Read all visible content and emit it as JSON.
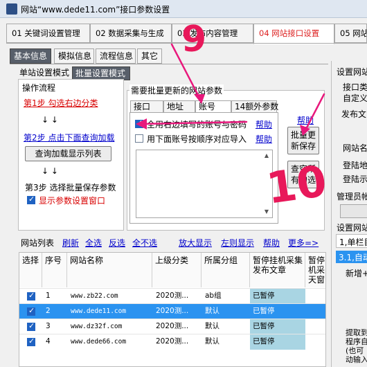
{
  "window": {
    "title": "网站“www.dede11.com”接口参数设置"
  },
  "main_tabs": [
    {
      "label": "01 关键词设置管理"
    },
    {
      "label": "02 数据采集与生成"
    },
    {
      "label": "03 发布内容管理"
    },
    {
      "label": "04 网站接口设置"
    },
    {
      "label": "05 网站"
    }
  ],
  "sub_tabs": [
    {
      "label": "基本信息"
    },
    {
      "label": "模拟信息"
    },
    {
      "label": "流程信息"
    },
    {
      "label": "其它"
    }
  ],
  "mode_tabs": [
    {
      "label": "单站设置模式"
    },
    {
      "label": "批量设置模式"
    }
  ],
  "flow": {
    "title": "操作流程",
    "step1": "第1步 勾选右边分类",
    "step2": "第2步 点击下面查询加载",
    "query_button": "查询加载显示列表",
    "step3": "第3步 选择批量保存参数",
    "show_params": "显示参数设置窗口",
    "arrows": "↓ ↓"
  },
  "batch": {
    "title": "需要批量更新的网站参数",
    "tabs": [
      {
        "label": "接口"
      },
      {
        "label": "地址"
      },
      {
        "label": "账号"
      },
      {
        "label": "14额外参数"
      }
    ],
    "help_top": "帮助",
    "option1": "全用右边填写的账号与密码",
    "option2": "用下面账号按顺序对应导入",
    "help1": "帮助",
    "help2": "帮助",
    "save_button": "批量更新保存",
    "query_all_button": "查空所有勾选"
  },
  "list_bar": {
    "title": "网站列表",
    "refresh": "刷新",
    "select_all": "全选",
    "invert": "反选",
    "select_none": "全不选",
    "zoom_in": "放大显示",
    "left_right": "左则显示",
    "help": "帮助",
    "more": "更多=>"
  },
  "table": {
    "headers": [
      "选择",
      "序号",
      "网站名称",
      "上级分类",
      "所属分组",
      "暂停挂机采集发布文章",
      "暂停机采天窗"
    ],
    "rows": [
      {
        "checked": true,
        "no": "1",
        "site": "www.zb22.com",
        "parent": "2020测...",
        "group": "ab组",
        "status": "已暂停"
      },
      {
        "checked": true,
        "no": "2",
        "site": "www.dede11.com",
        "parent": "2020测...",
        "group": "默认",
        "status": "已暂停"
      },
      {
        "checked": true,
        "no": "3",
        "site": "www.dz32f.com",
        "parent": "2020测...",
        "group": "默认",
        "status": "已暂停"
      },
      {
        "checked": true,
        "no": "4",
        "site": "www.dede66.com",
        "parent": "2020测...",
        "group": "默认",
        "status": "已暂停"
      }
    ]
  },
  "right_panel": {
    "title": "设置网站",
    "iface_type": "接口类",
    "custom": "自定义",
    "publish": "发布文",
    "site_name": "网站名",
    "login_addr": "登陆地",
    "login_show": "登陆示",
    "admin": "管理员帐",
    "settings_net": "设置网站",
    "column1": "1,单栏目",
    "auto": "3.1,自动",
    "add_new": "新增+",
    "extract": "提取到",
    "extract2": "程序自",
    "maybe": "(也可",
    "move": "动输入"
  },
  "annotations": {
    "mark_9": "9",
    "mark_10": "10"
  },
  "colors": {
    "accent_red": "#d22222",
    "selected_row": "#2b93f0",
    "paused_cell": "#a9d5e3",
    "annotation": "#e8187c"
  }
}
